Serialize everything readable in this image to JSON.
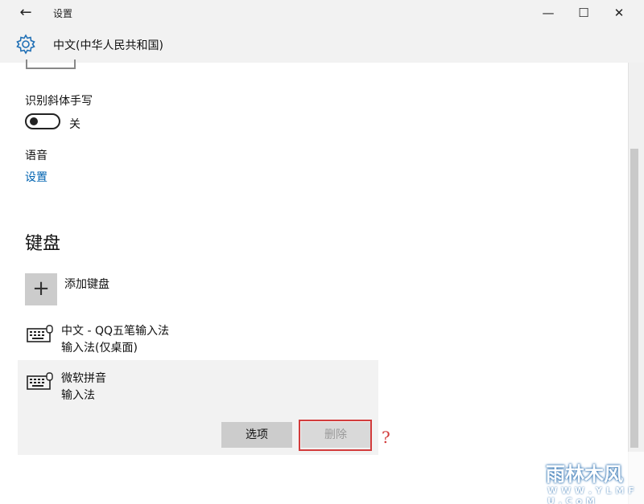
{
  "window": {
    "back_icon": "←",
    "title": "设置",
    "minimize_icon": "—",
    "maximize_icon": "☐",
    "close_icon": "✕"
  },
  "header": {
    "icon": "gear-icon",
    "title": "中文(中华人民共和国)"
  },
  "handwriting": {
    "label": "识别斜体手写",
    "toggle_state": "关"
  },
  "speech": {
    "label": "语音",
    "settings_link": "设置"
  },
  "keyboard": {
    "heading": "键盘",
    "add_label": "添加键盘",
    "add_icon": "+",
    "items": [
      {
        "name": "中文 - QQ五笔输入法",
        "type": "输入法(仅桌面)",
        "icon": "keyboard-icon"
      },
      {
        "name": "微软拼音",
        "type": "输入法",
        "icon": "keyboard-icon"
      }
    ],
    "options_label": "选项",
    "delete_label": "删除"
  },
  "annotation": {
    "mark": "?",
    "color": "#d23c3c"
  },
  "watermark": {
    "main": "雨林木风",
    "sub": "W W W . Y L M F U . C o M"
  },
  "colors": {
    "accent": "#0063b1",
    "panel": "#f2f2f2"
  }
}
